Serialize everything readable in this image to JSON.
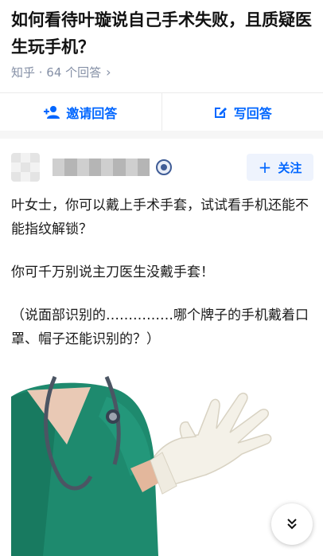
{
  "question": {
    "title": "如何看待叶璇说自己手术失败，且质疑医生玩手机？",
    "meta": "知乎 · 64 个回答"
  },
  "actions": {
    "invite_label": "邀请回答",
    "write_label": "写回答"
  },
  "author": {
    "follow_label": "关注"
  },
  "answer": {
    "paragraphs": [
      "叶女士，你可以戴上手术手套，试试看手机还能不能指纹解锁？",
      "你可千万别说主刀医生没戴手套！",
      "（说面部识别的……………哪个牌子的手机戴着口罩、帽子还能识别的？）"
    ]
  },
  "colors": {
    "accent": "#0066ff",
    "meta": "#8590a6",
    "scrub": "#1e8a6e"
  },
  "icons": [
    "invite-icon",
    "write-icon",
    "chevron-right-icon",
    "plus-icon",
    "badge-icon",
    "double-chevron-down-icon"
  ]
}
